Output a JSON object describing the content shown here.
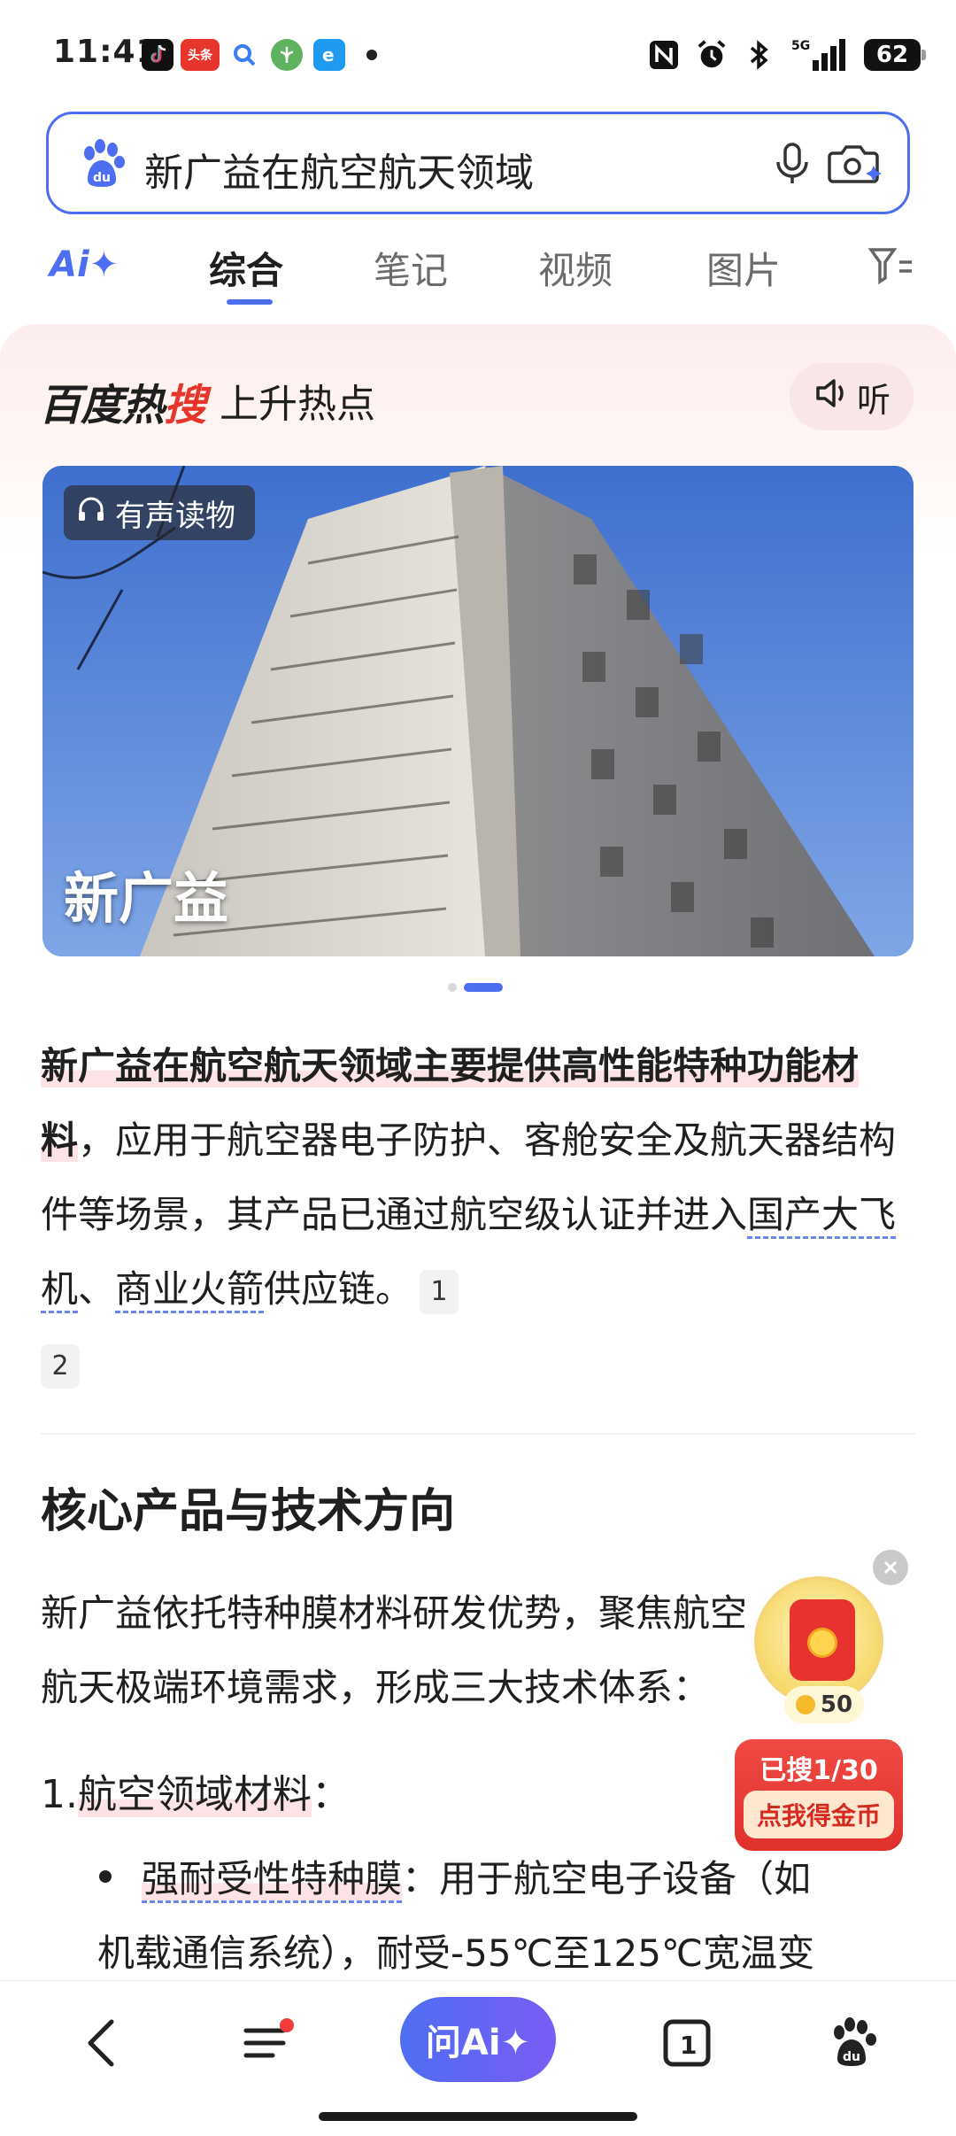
{
  "status_bar": {
    "time": "11:41",
    "apps": [
      "douyin-icon",
      "toutiao-icon",
      "search-icon",
      "app-icon",
      "app-icon"
    ],
    "toutiao_label": "头条",
    "battery": "62",
    "network": "5G"
  },
  "search": {
    "query": "新广益在航空航天领域"
  },
  "tabs": {
    "ai_label": "Ai✦",
    "items": [
      "综合",
      "笔记",
      "视频",
      "图片"
    ],
    "active": "综合"
  },
  "hot": {
    "brand_part1": "百度热",
    "brand_part2": "搜",
    "subtitle": "上升热点",
    "listen_label": "听",
    "audio_badge": "有声读物",
    "hero_title": "新广益"
  },
  "article": {
    "intro_bold": "新广益在航空航天领域主要提供高性能特种功能材料",
    "intro_rest_1": "，应用于航空器电子防护、客舱安全及航天器结构件等场景，其产品已通过航空级认证并进入",
    "intro_link_1": "国产大飞机",
    "intro_sep": "、",
    "intro_link_2": "商业火箭",
    "intro_end": "供应链。",
    "cite_1": "1",
    "cite_2": "2",
    "heading": "核心产品与技术方向",
    "para2": "新广益依托特种膜材料研发优势，聚焦航空航天极端环境需求，形成三大技术体系：",
    "list_num": "1.",
    "list_title": "航空领域材料",
    "list_colon": "：",
    "bullet_title": "强耐受性特种膜",
    "bullet_text_1": "：用于航空电子设备（如",
    "bullet_text_2": "机载通信系统），耐受-55℃至125℃宽温变"
  },
  "floating": {
    "coin_count": "50",
    "searched": "已搜1/30",
    "cta": "点我得金币"
  },
  "bottom_nav": {
    "ai_button": "问Ai✦",
    "tab_count": "1"
  },
  "colors": {
    "brand_blue": "#4e6ef2",
    "hot_red": "#e8352b"
  }
}
